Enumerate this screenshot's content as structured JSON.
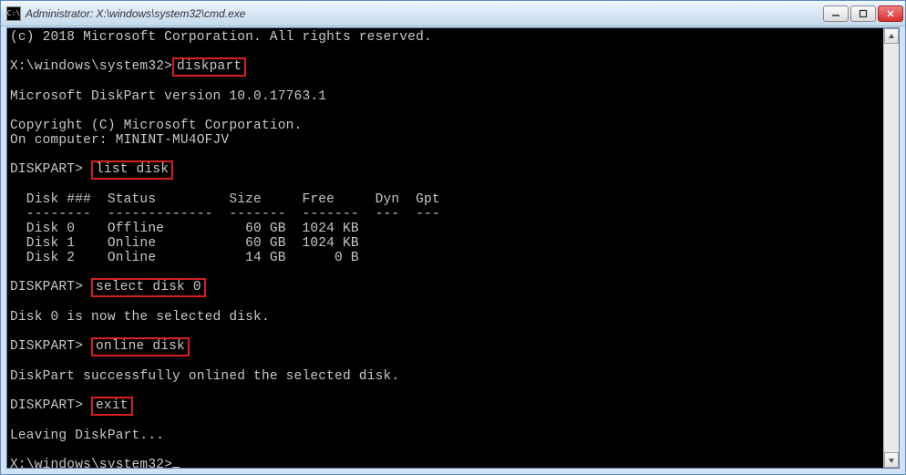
{
  "titlebar": {
    "icon_label": "C:\\",
    "title": "Administrator: X:\\windows\\system32\\cmd.exe"
  },
  "window_controls": {
    "minimize": "minimize",
    "maximize": "maximize",
    "close": "close"
  },
  "console": {
    "copyright_line": "(c) 2018 Microsoft Corporation. All rights reserved.",
    "prompt1_path": "X:\\windows\\system32>",
    "cmd_diskpart": "diskpart",
    "dp_version": "Microsoft DiskPart version 10.0.17763.1",
    "dp_copyright": "Copyright (C) Microsoft Corporation.",
    "dp_computer": "On computer: MININT-MU4OFJV",
    "dp_prompt": "DISKPART>",
    "cmd_listdisk": "list disk",
    "table_header": "  Disk ###  Status         Size     Free     Dyn  Gpt",
    "table_divider": "  --------  -------------  -------  -------  ---  ---",
    "disk_rows": [
      "  Disk 0    Offline          60 GB  1024 KB",
      "  Disk 1    Online           60 GB  1024 KB",
      "  Disk 2    Online           14 GB      0 B"
    ],
    "cmd_selectdisk": "select disk 0",
    "msg_selected": "Disk 0 is now the selected disk.",
    "cmd_onlinedisk": "online disk",
    "msg_onlined": "DiskPart successfully onlined the selected disk.",
    "cmd_exit": "exit",
    "msg_leaving": "Leaving DiskPart...",
    "prompt_final": "X:\\windows\\system32>"
  }
}
